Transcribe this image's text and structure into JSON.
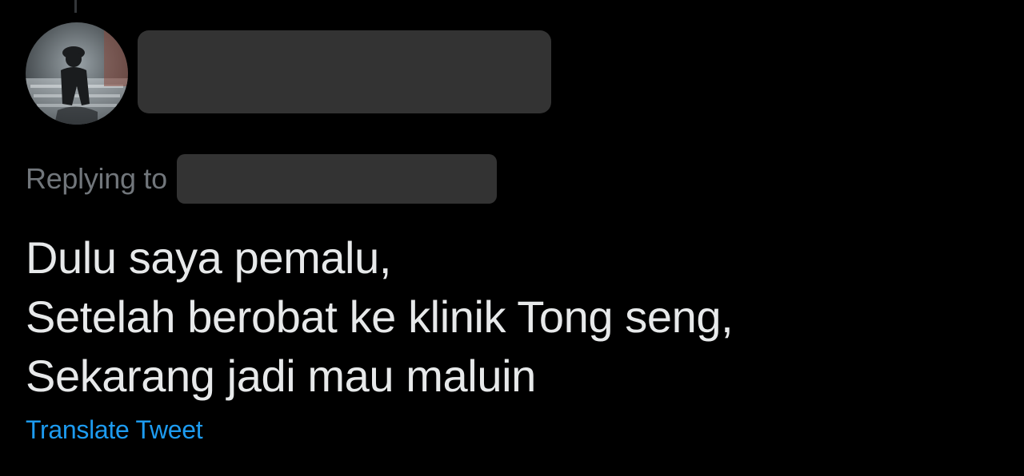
{
  "tweet": {
    "author": {
      "avatar_icon": "user-avatar-image",
      "name_redacted": true
    },
    "reply": {
      "label": "Replying to",
      "handle_redacted": true
    },
    "text_lines": [
      "Dulu saya pemalu,",
      "Setelah berobat ke klinik Tong seng,",
      "Sekarang jadi mau maluin"
    ],
    "translate_label": "Translate Tweet"
  },
  "colors": {
    "background": "#000000",
    "text_primary": "#e7e9ea",
    "text_secondary": "#71767b",
    "link": "#1d9bf0",
    "redaction": "#333333"
  }
}
